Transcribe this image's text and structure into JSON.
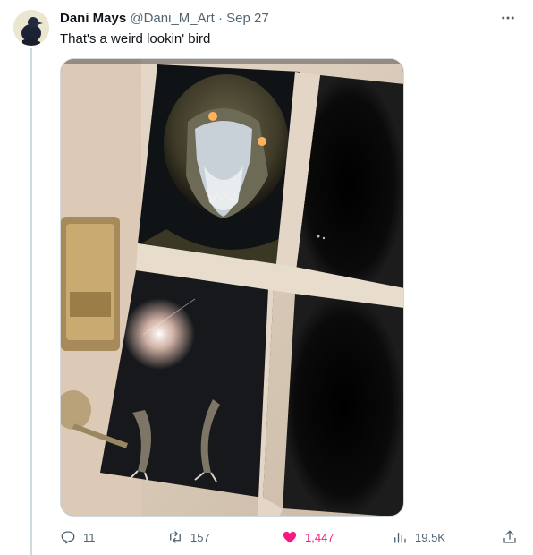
{
  "tweet": {
    "author_name": "Dani Mays",
    "author_handle": "@Dani_M_Art",
    "separator": "·",
    "date": "Sep 27",
    "text": "That's a weird lookin' bird"
  },
  "actions": {
    "replies": "11",
    "retweets": "157",
    "likes": "1,447",
    "views": "19.5K"
  },
  "colors": {
    "like_active": "#f91880",
    "muted": "#536471",
    "text": "#0f1419"
  },
  "icons": {
    "more": "more-icon",
    "reply": "reply-icon",
    "retweet": "retweet-icon",
    "like": "heart-icon",
    "views": "views-icon",
    "share": "share-icon"
  }
}
